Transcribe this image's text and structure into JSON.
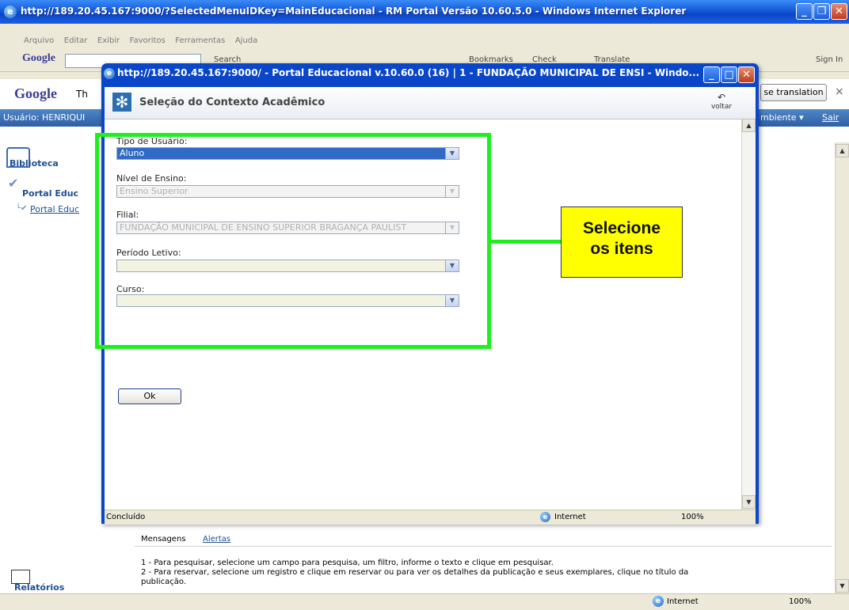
{
  "browser": {
    "title": "http://189.20.45.167:9000/?SelectedMenuIDKey=MainEducacional - RM Portal Versão 10.60.5.0 - Windows Internet Explorer",
    "menu": [
      "Arquivo",
      "Editar",
      "Exibir",
      "Favoritos",
      "Ferramentas",
      "Ajuda"
    ],
    "google_label": "Google",
    "google_toolbar": [
      "Search",
      "Bookmarks",
      "Check",
      "Translate",
      "Sign In"
    ],
    "google_translate_prefix": "Th",
    "translate_button": "se translation",
    "status_text": "Internet",
    "zoom": "100%"
  },
  "portal": {
    "user_label": "Usuário: HENRIQUI",
    "ambiente_label": "mbiente",
    "sair_label": "Sair",
    "sidebar": {
      "biblioteca": "Biblioteca",
      "portal": "Portal Educ",
      "portal_link": "Portal Educ",
      "relatorios": "Relatórios"
    },
    "messages": {
      "tab_mensagens": "Mensagens",
      "tab_alertas": "Alertas",
      "line1": "1 - Para pesquisar, selecione um campo para pesquisa, um filtro, informe o texto e clique em pesquisar.",
      "line2": "2 - Para reservar, selecione um registro e clique em reservar ou para ver os detalhes da publicação e seus exemplares, clique no título da",
      "line3": "publicação."
    }
  },
  "popup": {
    "title": "http://189.20.45.167:9000/ - Portal Educacional v.10.60.0 (16) | 1 - FUNDAÇÃO MUNICIPAL DE ENSI - Windo...",
    "header_title": "Seleção do Contexto Acadêmico",
    "voltar": "voltar",
    "fields": {
      "tipo_label": "Tipo de Usuário:",
      "tipo_value": "Aluno",
      "nivel_label": "Nível de Ensino:",
      "nivel_value": "Ensino Superior",
      "filial_label": "Filial:",
      "filial_value": "FUNDAÇÃO MUNICIPAL DE ENSINO SUPERIOR BRAGANÇA PAULIST",
      "periodo_label": "Período Letivo:",
      "periodo_value": "",
      "curso_label": "Curso:",
      "curso_value": ""
    },
    "ok_button": "Ok",
    "status_left": "Concluído",
    "status_zone": "Internet",
    "status_zoom": "100%"
  },
  "annotation": {
    "line1": "Selecione",
    "line2": "os itens"
  },
  "colors": {
    "highlight": "#1ef01e",
    "callout": "#ffff00",
    "xp_blue": "#0a46c8"
  }
}
